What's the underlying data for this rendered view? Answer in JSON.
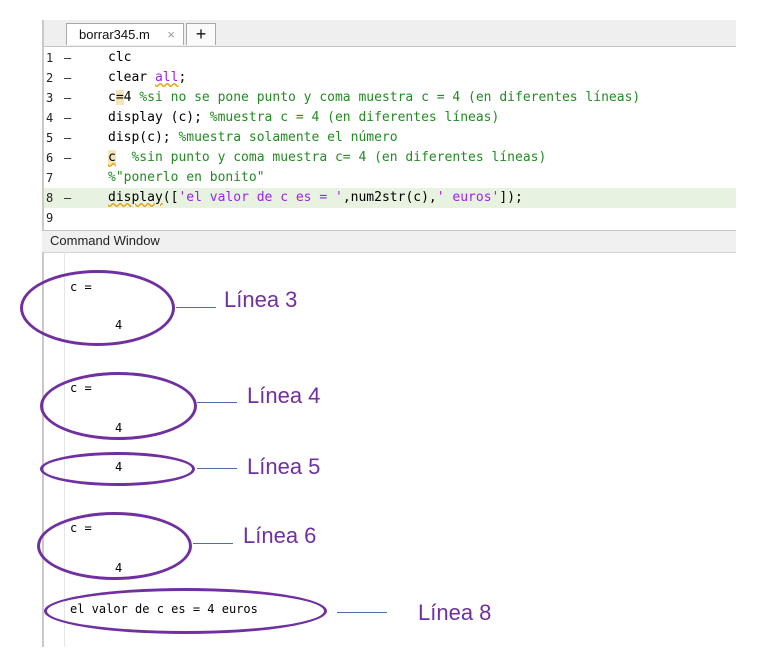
{
  "editor": {
    "tab_file": "borrar345.m",
    "tab_close": "×",
    "tab_add": "+",
    "line_numbers": [
      "1",
      "2",
      "3",
      "4",
      "5",
      "6",
      "7",
      "8",
      "9"
    ],
    "line_marker": "–",
    "lines": {
      "l1": "clc",
      "l2_kw": "clear ",
      "l2_arg": "all",
      "l2_end": ";",
      "l3_c": "c",
      "l3_eq": "=",
      "l3_val": "4 ",
      "l3_cmt": "%si no se pone punto y coma muestra c = 4 (en diferentes líneas)",
      "l4_code": "display (c); ",
      "l4_cmt": "%muestra c = 4 (en diferentes líneas)",
      "l5_code": "disp(c); ",
      "l5_cmt": "%muestra solamente el número",
      "l6_code": "c",
      "l6_cmt": "  %sin punto y coma muestra c= 4 (en diferentes líneas)",
      "l7_cmt": "%\"ponerlo en bonito\"",
      "l8_fn": "display",
      "l8_a": "([",
      "l8_s1": "'el valor de c es = '",
      "l8_b": ",num2str(c),",
      "l8_s2": "' euros'",
      "l8_c": "]);"
    }
  },
  "command_window": {
    "title": "Command Window",
    "outputs": {
      "o1_label": "c =",
      "o1_val": "4",
      "o2_label": "c =",
      "o2_val": "4",
      "o3_val": "4",
      "o4_label": "c =",
      "o4_val": "4",
      "o5_text": "el valor de c es = 4 euros"
    }
  },
  "annotations": {
    "a1": "Línea 3",
    "a2": "Línea 4",
    "a3": "Línea 5",
    "a4": "Línea 6",
    "a5": "Línea 8"
  },
  "colors": {
    "annotation": "#7030a0",
    "comment": "#228b22",
    "string": "#a020f0",
    "current_line": "#e8f2e0"
  }
}
